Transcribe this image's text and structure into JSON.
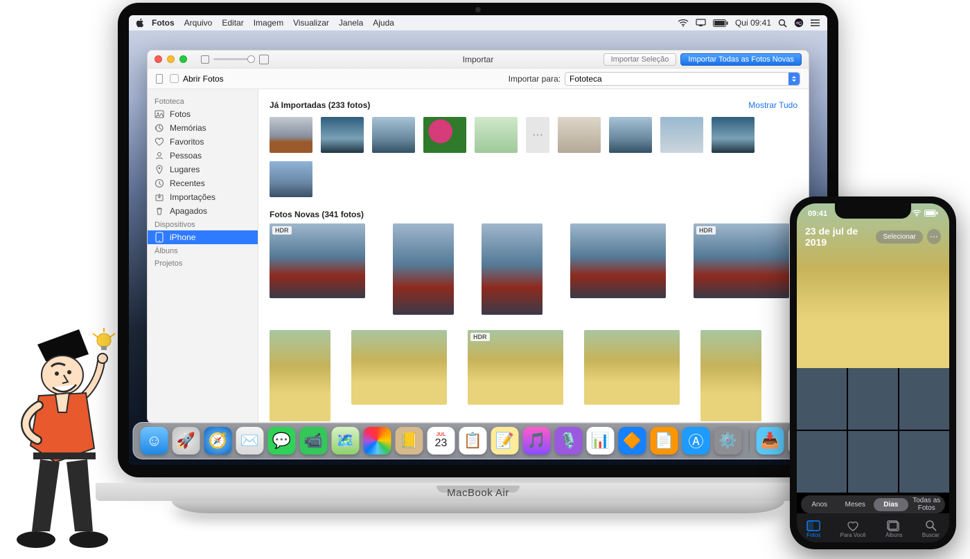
{
  "menubar": {
    "app": "Fotos",
    "items": [
      "Arquivo",
      "Editar",
      "Imagem",
      "Visualizar",
      "Janela",
      "Ajuda"
    ],
    "clock": "Qui 09:41"
  },
  "window": {
    "title": "Importar",
    "btn_disabled": "Importar Seleção",
    "btn_primary": "Importar Todas as Fotos Novas",
    "open_label": "Abrir Fotos",
    "target_label": "Importar para:",
    "target_value": "Fototeca"
  },
  "sidebar": {
    "section_library": "Fototeca",
    "library_items": [
      "Fotos",
      "Memórias",
      "Favoritos",
      "Pessoas",
      "Lugares",
      "Recentes",
      "Importações",
      "Apagados"
    ],
    "section_devices": "Dispositivos",
    "device": "iPhone",
    "section_albums": "Álbuns",
    "section_projects": "Projetos"
  },
  "content": {
    "imported_title": "Já Importadas (233 fotos)",
    "show_all": "Mostrar Tudo",
    "new_title": "Fotos Novas (341 fotos)",
    "hdr": "HDR"
  },
  "dock": {
    "finder": "Finder",
    "launchpad": "Launchpad",
    "safari": "Safari",
    "mail": "Mail",
    "messages": "Mensagens",
    "facetime": "FaceTime",
    "maps": "Mapas",
    "photos": "Fotos",
    "contacts": "Contatos",
    "calendar": "Calendário",
    "calendar_day": "23",
    "calendar_mon": "JUL",
    "reminders": "Lembretes",
    "notes": "Notas",
    "music": "Música",
    "podcasts": "Podcasts",
    "numbers": "Numbers",
    "keynote": "Keynote",
    "pages": "Pages",
    "appstore": "App Store",
    "settings": "Ajustes",
    "trash": "Lixo",
    "downloads": "Transferências"
  },
  "macbook": {
    "label": "MacBook Air"
  },
  "iphone": {
    "time": "09:41",
    "date": "23 de jul de 2019",
    "select": "Selecionar",
    "segments": [
      "Anos",
      "Meses",
      "Dias",
      "Todas as Fotos"
    ],
    "segment_active": 2,
    "tabs": [
      "Fotos",
      "Para Você",
      "Álbuns",
      "Buscar"
    ],
    "tab_active": 0
  }
}
